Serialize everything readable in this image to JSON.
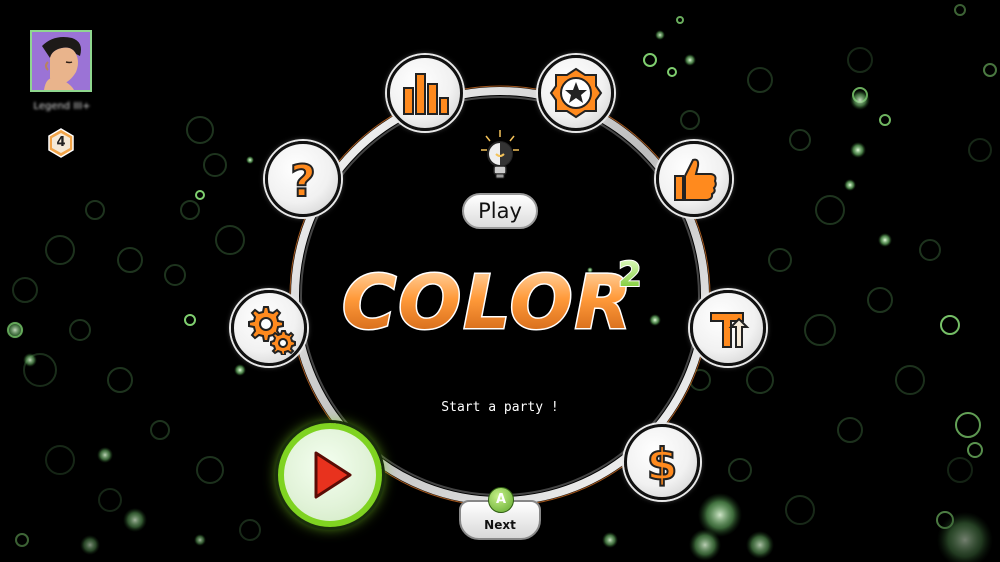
{
  "player": {
    "name": "Legend III+",
    "level": "4"
  },
  "menu": {
    "play_label": "Play",
    "status_text": "Start a party !",
    "next_label": "Next",
    "next_key": "A",
    "items": [
      {
        "icon": "stats-bars-icon"
      },
      {
        "icon": "star-badge-icon"
      },
      {
        "icon": "thumbs-up-icon"
      },
      {
        "icon": "leaderboard-arrow-icon"
      },
      {
        "icon": "dollar-icon"
      },
      {
        "icon": "settings-gears-icon"
      },
      {
        "icon": "help-question-icon"
      }
    ]
  },
  "logo": {
    "word": "COLOR",
    "superscript": "2"
  },
  "colors": {
    "accent_orange": "#ff8a1e",
    "accent_green": "#7fd321",
    "start_red": "#e8321e"
  }
}
